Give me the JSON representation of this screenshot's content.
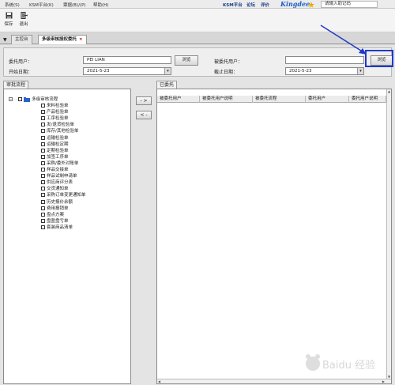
{
  "menu": {
    "items": [
      "系统(S)",
      "KSM平台(K)",
      "票据(B)/(P)",
      "帮助(H)"
    ],
    "brand_links": [
      "KSM平台",
      "论坛",
      "评价"
    ],
    "brand_logo": "Kingdee",
    "search_placeholder": "请输入助记码"
  },
  "toolbar": {
    "save_label": "保存",
    "exit_label": "退出"
  },
  "tabs": [
    {
      "label": "主控台"
    },
    {
      "label": "多级审核授权委托",
      "close": "×"
    }
  ],
  "form": {
    "delegator_label": "委托用户：",
    "delegator_value": "PEI LIAN",
    "start_date_label": "开始日期：",
    "start_date_value": "2021-5-23",
    "browse_label": "浏览",
    "delegatee_label": "被委托用户：",
    "delegatee_value": "",
    "end_date_label": "截止日期：",
    "end_date_value": "2021-5-23",
    "browse2_label": "浏览"
  },
  "left_panel": {
    "tab_label": "审批流程",
    "root_label": "多级审核流程",
    "items": [
      "来料检验单",
      "产品检验单",
      "工序检验单",
      "发/退货检验单",
      "库存/其他检验单",
      "运输检验单",
      "运输检定期",
      "定期检验单",
      "加签工序单",
      "采购/委外对账单",
      "样品交接单",
      "样品试制申请单",
      "供应商评分表",
      "交货通知单",
      "采购订单变更通知单",
      "历史报价余额",
      "费用报销单",
      "盘点方案",
      "盘盈盘亏单",
      "套装商品清单"
    ]
  },
  "move": {
    "right": "- >",
    "left": "< -"
  },
  "right_panel": {
    "tab_label": "已委托",
    "columns": [
      "被委托用户",
      "被委托用户说明",
      "被委托流程",
      "委托用户",
      "委托用户说明"
    ]
  },
  "colors": {
    "annotation": "#2039c8",
    "tab_close": "#cc0000"
  },
  "watermark_text": "Baidu 经验"
}
